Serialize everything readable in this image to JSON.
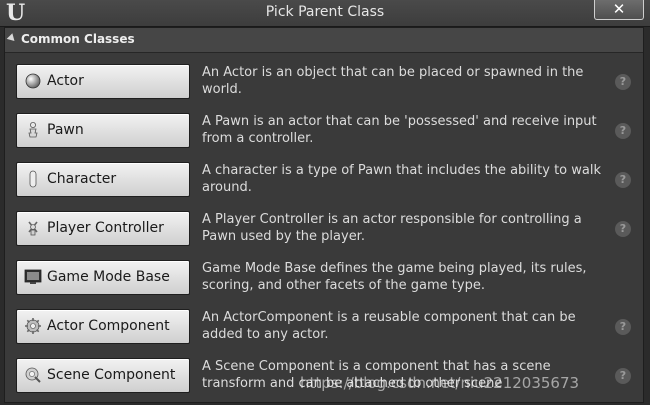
{
  "window": {
    "title": "Pick Parent Class",
    "close_label": "✕"
  },
  "section": {
    "label": "Common Classes"
  },
  "classes": [
    {
      "label": "Actor",
      "description": "An Actor is an object that can be placed or spawned in the world.",
      "icon": "actor-sphere-icon"
    },
    {
      "label": "Pawn",
      "description": "A Pawn is an actor that can be 'possessed' and receive input from a controller.",
      "icon": "pawn-icon"
    },
    {
      "label": "Character",
      "description": "A character is a type of Pawn that includes the ability to walk around.",
      "icon": "character-capsule-icon"
    },
    {
      "label": "Player Controller",
      "description": "A Player Controller is an actor responsible for controlling a Pawn used by the player.",
      "icon": "player-controller-icon"
    },
    {
      "label": "Game Mode Base",
      "description": "Game Mode Base defines the game being played, its rules, scoring, and other facets of the game type.",
      "icon": "game-mode-monitor-icon"
    },
    {
      "label": "Actor Component",
      "description": "An ActorComponent is a reusable component that can be added to any actor.",
      "icon": "actor-component-icon"
    },
    {
      "label": "Scene Component",
      "description": "A Scene Component is a component that has a scene transform and can be attached to other scene",
      "icon": "scene-component-icon"
    }
  ],
  "help_glyph": "?",
  "watermark": "https://blog.csdn.net/niu2212035673"
}
